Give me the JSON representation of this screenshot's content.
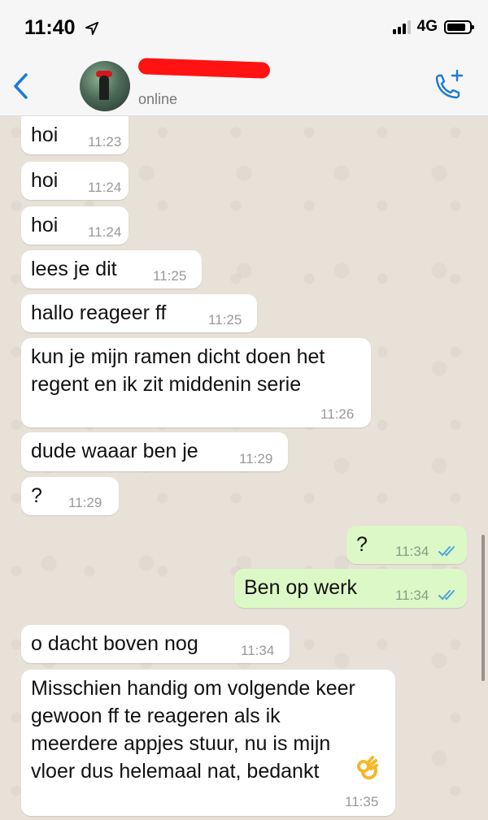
{
  "status_bar": {
    "time": "11:40",
    "network": "4G"
  },
  "header": {
    "status": "online"
  },
  "messages": [
    {
      "text": "hoi",
      "time": "11:23",
      "direction": "in"
    },
    {
      "text": "hoi",
      "time": "11:24",
      "direction": "in"
    },
    {
      "text": "hoi",
      "time": "11:24",
      "direction": "in"
    },
    {
      "text": "lees je dit",
      "time": "11:25",
      "direction": "in"
    },
    {
      "text": "hallo reageer ff",
      "time": "11:25",
      "direction": "in"
    },
    {
      "line1": "kun je mijn ramen dicht doen het",
      "line2": "regent en ik zit middenin serie",
      "time": "11:26",
      "direction": "in"
    },
    {
      "text": "dude waaar ben je",
      "time": "11:29",
      "direction": "in"
    },
    {
      "text": "?",
      "time": "11:29",
      "direction": "in"
    },
    {
      "text": "?",
      "time": "11:34",
      "direction": "out",
      "read": true
    },
    {
      "text": "Ben op werk",
      "time": "11:34",
      "direction": "out",
      "read": true
    },
    {
      "text": "o dacht boven nog",
      "time": "11:34",
      "direction": "in"
    },
    {
      "line1": "Misschien handig om volgende keer",
      "line2": "gewoon ff te reageren als ik",
      "line3": "meerdere appjes stuur, nu is mijn",
      "line4": "vloer dus helemaal nat, bedankt",
      "emoji": "ok-hand-emoji",
      "time": "11:35",
      "direction": "in"
    }
  ],
  "colors": {
    "incoming_bubble": "#ffffff",
    "outgoing_bubble": "#dcf8c6",
    "accent": "#1b7bd6",
    "read_ticks": "#4fa3e0"
  },
  "icons": [
    "location-arrow-icon",
    "signal-icon",
    "battery-icon",
    "back-chevron-icon",
    "call-add-icon",
    "read-ticks-icon"
  ]
}
